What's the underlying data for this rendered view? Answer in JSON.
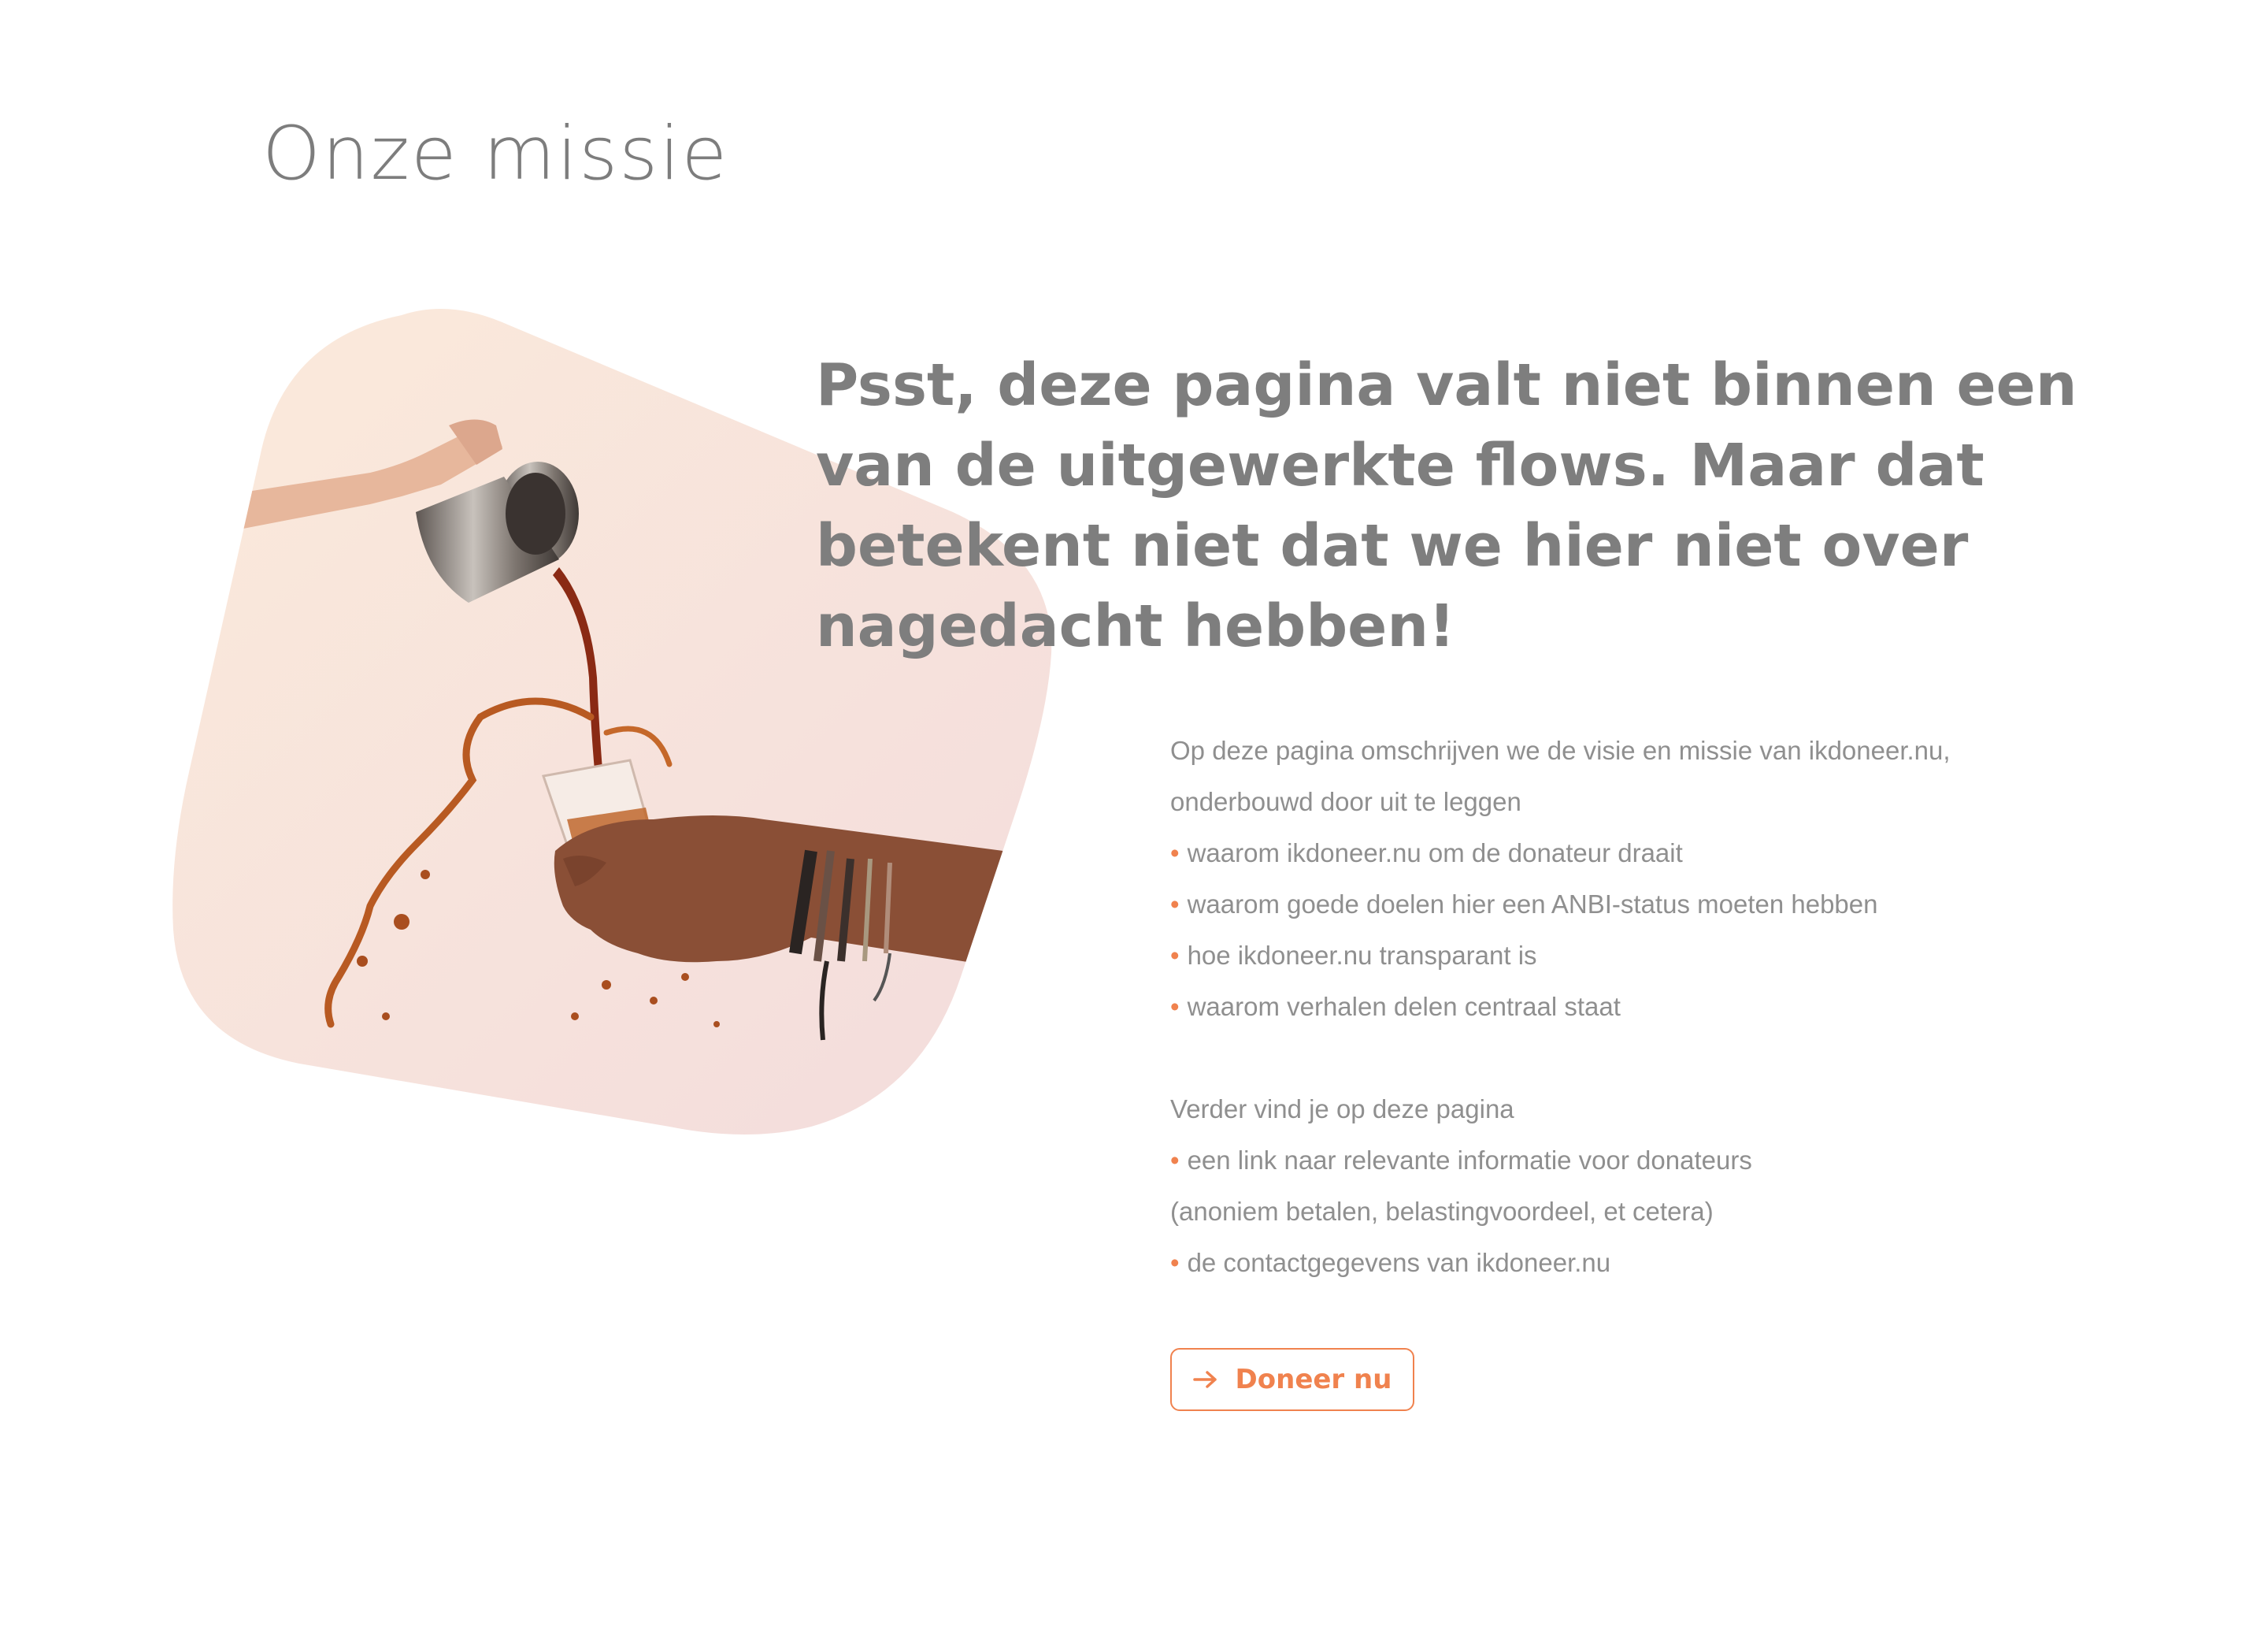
{
  "page": {
    "title": "Onze missie"
  },
  "hero": {
    "image_subject": "hands pouring coffee from a metal jug into a glass with splashes",
    "headline": "Psst, deze pagina valt niet binnen een van de uitgewerkte flows. Maar dat betekent niet dat we hier niet over nagedacht hebben!"
  },
  "content": {
    "intro_line1": "Op deze pagina omschrijven we de visie en missie van ikdoneer.nu,",
    "intro_line2": "onderbouwd door uit te leggen",
    "bullets": [
      "waarom ikdoneer.nu om de donateur draait",
      "waarom goede doelen hier een ANBI-status moeten hebben",
      "hoe ikdoneer.nu transparant is",
      "waarom verhalen delen centraal staat"
    ],
    "more_intro": "Verder vind je op deze pagina",
    "more_bullets": [
      "een link naar relevante informatie voor donateurs"
    ],
    "more_note": "(anoniem betalen, belastingvoordeel, et cetera)",
    "more_bullets_2": [
      "de contactgegevens van ikdoneer.nu"
    ],
    "bullet_symbol": "•"
  },
  "cta": {
    "label": "Doneer nu",
    "icon": "arrow-right-icon"
  },
  "colors": {
    "accent": "#f0824e",
    "text": "#8f8f8f",
    "headline": "#7e7e7e",
    "background": "#ffffff"
  }
}
